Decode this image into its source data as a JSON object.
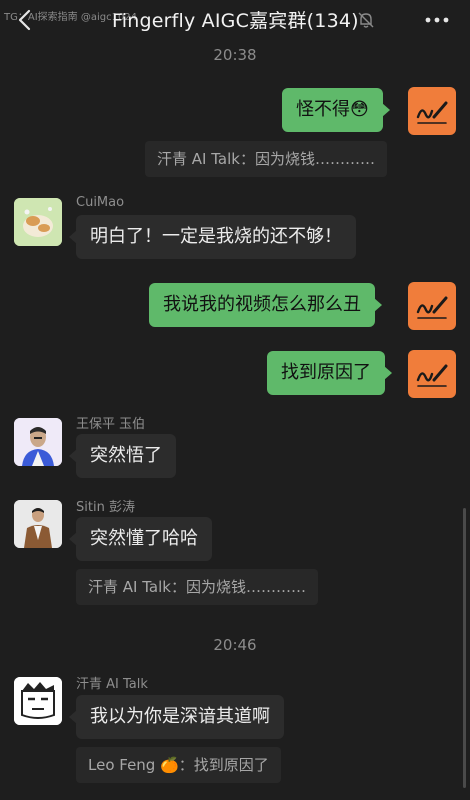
{
  "header": {
    "watermark": "TG：AI探索指南 @aigc1024",
    "title": "Fingerfly AIGC嘉宾群(134)"
  },
  "times": [
    "20:38",
    "20:46"
  ],
  "messages": {
    "m1": "怪不得😳",
    "q1": "汗青 AI Talk：因为烧钱…………",
    "s_cuimao": "CuiMao",
    "m2": "明白了！一定是我烧的还不够！",
    "m3": "我说我的视频怎么那么丑",
    "m4": "找到原因了",
    "s_wang": "王保平 玉伯",
    "m5": "突然悟了",
    "s_sitin": "Sitin 彭涛",
    "m6": "突然懂了哈哈",
    "q2": "汗青 AI Talk：因为烧钱…………",
    "s_hanqing": "汗青 AI Talk",
    "m7": "我以为你是深谙其道啊",
    "q3": "Leo Feng 🍊：找到原因了"
  },
  "icons": {
    "back": "chevron-left-icon",
    "mute": "bell-off-icon",
    "more": "more-dots-icon"
  },
  "colors": {
    "background": "#1e1e1e",
    "my_bubble": "#5fb96a",
    "other_bubble": "#2c2c2c",
    "my_avatar": "#f07d3b"
  }
}
